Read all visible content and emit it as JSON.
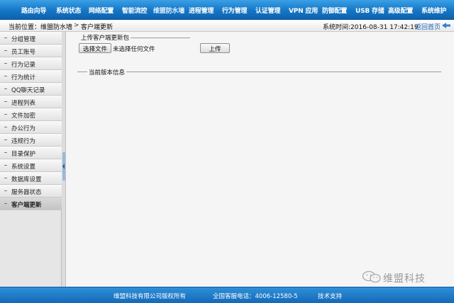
{
  "nav": {
    "items": [
      "路由向导",
      "系统状态",
      "网络配置",
      "智能流控",
      "维盟防水墙",
      "进程管理",
      "行为管理",
      "认证管理",
      "VPN 应用",
      "防御配置",
      "USB 存储",
      "高级配置",
      "系统维护"
    ],
    "active_index": 4
  },
  "breadcrumb": {
    "label": "当前位置：维盟防水墙",
    "arrow": ">",
    "current": "客户端更新",
    "time_label": "系统时间:2016-08-31  17:42:19",
    "home_link": "返回首页"
  },
  "sidebar": {
    "items": [
      "分组管理",
      "员工账号",
      "行为记录",
      "行为统计",
      "QQ聊天记录",
      "进程列表",
      "文件加密",
      "办公行为",
      "违规行为",
      "目录保护",
      "系统设置",
      "数据库设置",
      "服务器状态",
      "客户端更新"
    ],
    "selected_index": 13
  },
  "upload_section": {
    "legend": "上传客户端更新包",
    "choose_file_button": "选择文件",
    "no_file_text": "未选择任何文件",
    "upload_button": "上传"
  },
  "version_section": {
    "legend": "当前版本信息"
  },
  "footer": {
    "copyright": "维盟科技有限公司版权所有",
    "hotline": "全国客服电话：4006-12580-5",
    "support": "技术支持"
  },
  "watermark": {
    "text": "维盟科技",
    "icon": "wechat-logo-icon"
  },
  "colors": {
    "nav_blue": "#1576c6",
    "footer_blue": "#1469b8",
    "link_blue": "#1a5fb0"
  }
}
